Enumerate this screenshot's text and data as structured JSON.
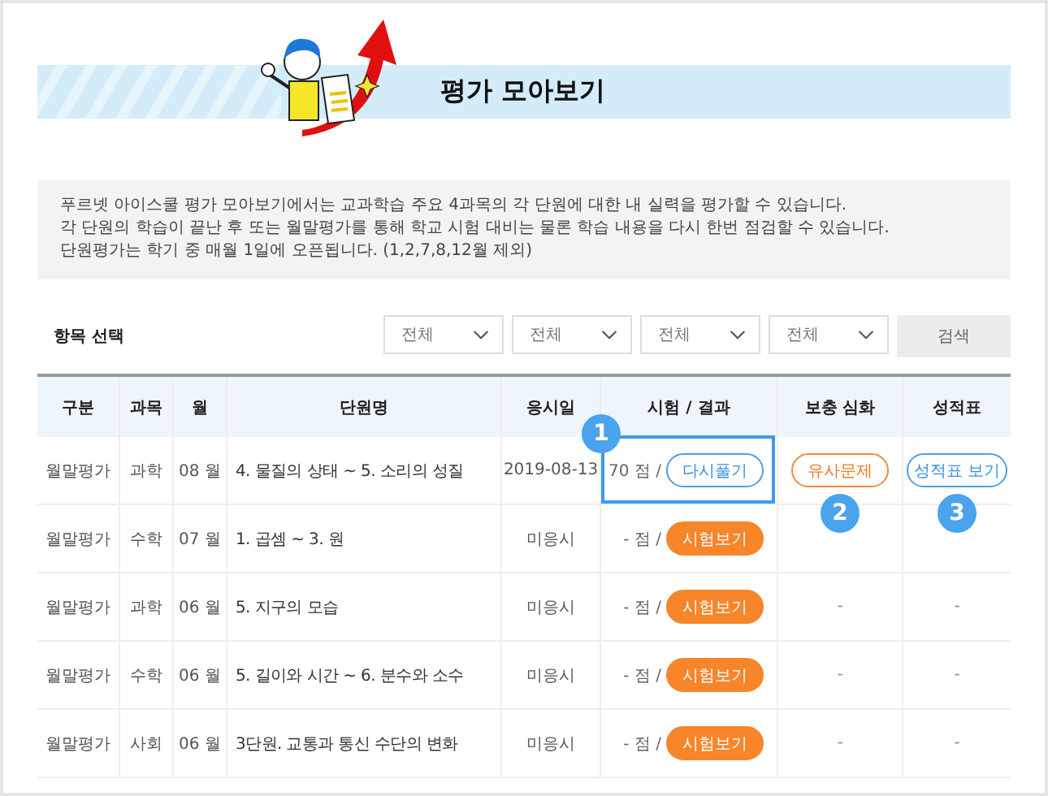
{
  "header": {
    "title": "평가 모아보기"
  },
  "notice": [
    "푸르넷 아이스쿨 평가 모아보기에서는 교과학습 주요 4과목의 각 단원에 대한 내 실력을 평가할 수 있습니다.",
    "각 단원의 학습이 끝난 후 또는 월말평가를 통해 학교 시험 대비는 물론 학습 내용을 다시 한번 점검할 수 있습니다.",
    "단원평가는 학기 중 매월 1일에 오픈됩니다. (1,2,7,8,12월 제외)"
  ],
  "filter": {
    "label": "항목 선택",
    "selects": [
      {
        "value": "전체"
      },
      {
        "value": "전체"
      },
      {
        "value": "전체"
      },
      {
        "value": "전체"
      }
    ],
    "search_button": "검색"
  },
  "table": {
    "columns": [
      "구분",
      "과목",
      "월",
      "단원명",
      "응시일",
      "시험 / 결과",
      "보충 심화",
      "성적표"
    ],
    "rows": [
      {
        "type": "월말평가",
        "subject": "과학",
        "month": "08 월",
        "unit": "4. 물질의 상태 ~ 5. 소리의 성질",
        "date": "2019-08-13",
        "score": "70 점 /",
        "action": {
          "kind": "retry",
          "label": "다시풀기"
        },
        "highlighted": true,
        "result_callout": "1",
        "supplement": {
          "kind": "button",
          "label": "유사문제"
        },
        "supplement_callout": "2",
        "report": {
          "kind": "button",
          "label": "성적표 보기"
        },
        "report_callout": "3"
      },
      {
        "type": "월말평가",
        "subject": "수학",
        "month": "07 월",
        "unit": "1. 곱셈 ~ 3. 원",
        "date": "미응시",
        "score": "- 점 /",
        "action": {
          "kind": "start",
          "label": "시험보기"
        },
        "highlighted": false
      },
      {
        "type": "월말평가",
        "subject": "과학",
        "month": "06 월",
        "unit": "5. 지구의 모습",
        "date": "미응시",
        "score": "- 점 /",
        "action": {
          "kind": "start",
          "label": "시험보기"
        },
        "highlighted": false,
        "supplement": {
          "kind": "dash",
          "label": "-"
        },
        "report": {
          "kind": "dash",
          "label": "-"
        }
      },
      {
        "type": "월말평가",
        "subject": "수학",
        "month": "06 월",
        "unit": "5. 길이와 시간 ~ 6. 분수와 소수",
        "date": "미응시",
        "score": "- 점 /",
        "action": {
          "kind": "start",
          "label": "시험보기"
        },
        "highlighted": false,
        "supplement": {
          "kind": "dash",
          "label": "-"
        },
        "report": {
          "kind": "dash",
          "label": "-"
        }
      },
      {
        "type": "월말평가",
        "subject": "사회",
        "month": "06 월",
        "unit": "3단원. 교통과 통신 수단의 변화",
        "date": "미응시",
        "score": "- 점 /",
        "action": {
          "kind": "start",
          "label": "시험보기"
        },
        "highlighted": false,
        "supplement": {
          "kind": "dash",
          "label": "-"
        },
        "report": {
          "kind": "dash",
          "label": "-"
        }
      }
    ]
  }
}
